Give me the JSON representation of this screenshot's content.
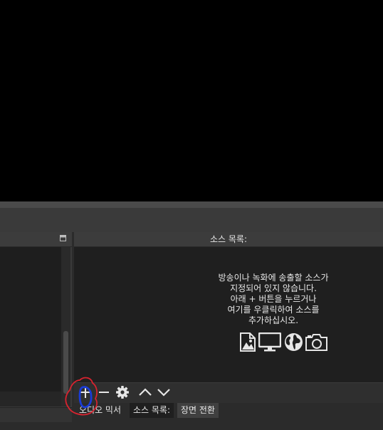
{
  "sources_dock": {
    "title": "소스 목록:",
    "empty_message": [
      "방송이나 녹화에 송출할 소스가",
      "지정되어 있지 않습니다.",
      "아래 + 버튼을 누르거나",
      "여기를 우클릭하여 소스를",
      "추가하십시오."
    ],
    "source_type_icons": [
      "image-icon",
      "display-capture-icon",
      "browser-globe-icon",
      "camera-icon"
    ]
  },
  "controls": [
    "add-icon",
    "remove-icon",
    "gear-icon",
    "move-up-icon",
    "move-down-icon"
  ],
  "tabs": [
    "오디오 믹서",
    "소스 목록:",
    "장면 전환"
  ],
  "colors": {
    "annotation_red": "#d9232f",
    "annotation_blue": "#1a3cd6"
  }
}
